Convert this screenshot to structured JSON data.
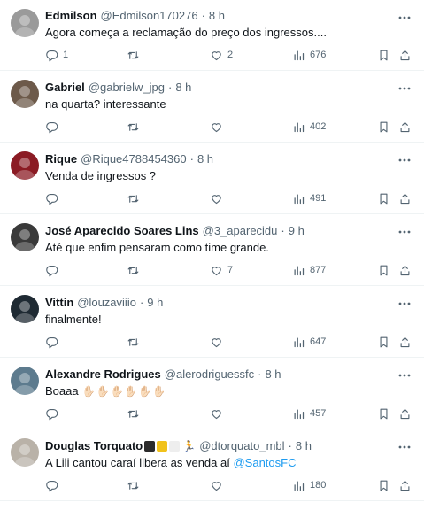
{
  "replies": [
    {
      "name": "Edmilson",
      "handle": "@Edmilson170276",
      "time": "8 h",
      "text": "Agora começa a reclamação do preço dos ingressos....",
      "replies": "1",
      "retweets": "",
      "likes": "2",
      "views": "676",
      "avatar_color": "#9a9a9a"
    },
    {
      "name": "Gabriel",
      "handle": "@gabrielw_jpg",
      "time": "8 h",
      "text": "na quarta? interessante",
      "replies": "",
      "retweets": "",
      "likes": "",
      "views": "402",
      "avatar_color": "#6d5a4a"
    },
    {
      "name": "Rique",
      "handle": "@Rique4788454360",
      "time": "8 h",
      "text": "Venda de ingressos ?",
      "replies": "",
      "retweets": "",
      "likes": "",
      "views": "491",
      "avatar_color": "#8b1b24"
    },
    {
      "name": "José Aparecido Soares Lins",
      "handle": "@3_aparecidu",
      "time": "9 h",
      "text": "Até que enfim pensaram como time grande.",
      "replies": "",
      "retweets": "",
      "likes": "7",
      "views": "877",
      "avatar_color": "#3a3a3a"
    },
    {
      "name": "Vittin",
      "handle": "@louzaviiio",
      "time": "9 h",
      "text": "finalmente!",
      "replies": "",
      "retweets": "",
      "likes": "",
      "views": "647",
      "avatar_color": "#1f2a33"
    },
    {
      "name": "Alexandre Rodrigues",
      "handle": "@alerodriguessfc",
      "time": "8 h",
      "text": "Boaaa",
      "text_emoji": "✋🏻✋🏻✋🏻✋🏻✋🏻✋🏻",
      "replies": "",
      "retweets": "",
      "likes": "",
      "views": "457",
      "avatar_color": "#5d7b8e"
    },
    {
      "name": "Douglas Torquato",
      "name_badges": [
        "#2b2b2b",
        "#f1c21b",
        "#eeeeee"
      ],
      "name_emoji": "🏃",
      "handle": "@dtorquato_mbl",
      "time": "8 h",
      "text": "A Lili cantou caraí libera as venda aí ",
      "mention": "@SantosFC",
      "replies": "",
      "retweets": "",
      "likes": "",
      "views": "180",
      "avatar_color": "#b9b2a8"
    }
  ],
  "colors": {
    "text_primary": "#0f1419",
    "text_secondary": "#536471",
    "link": "#1d9bf0",
    "divider": "#eff3f4"
  },
  "icons": {
    "reply": "reply-icon",
    "retweet": "retweet-icon",
    "like": "heart-icon",
    "views": "views-chart-icon",
    "bookmark": "bookmark-icon",
    "share": "share-icon",
    "more": "more-options-icon"
  }
}
